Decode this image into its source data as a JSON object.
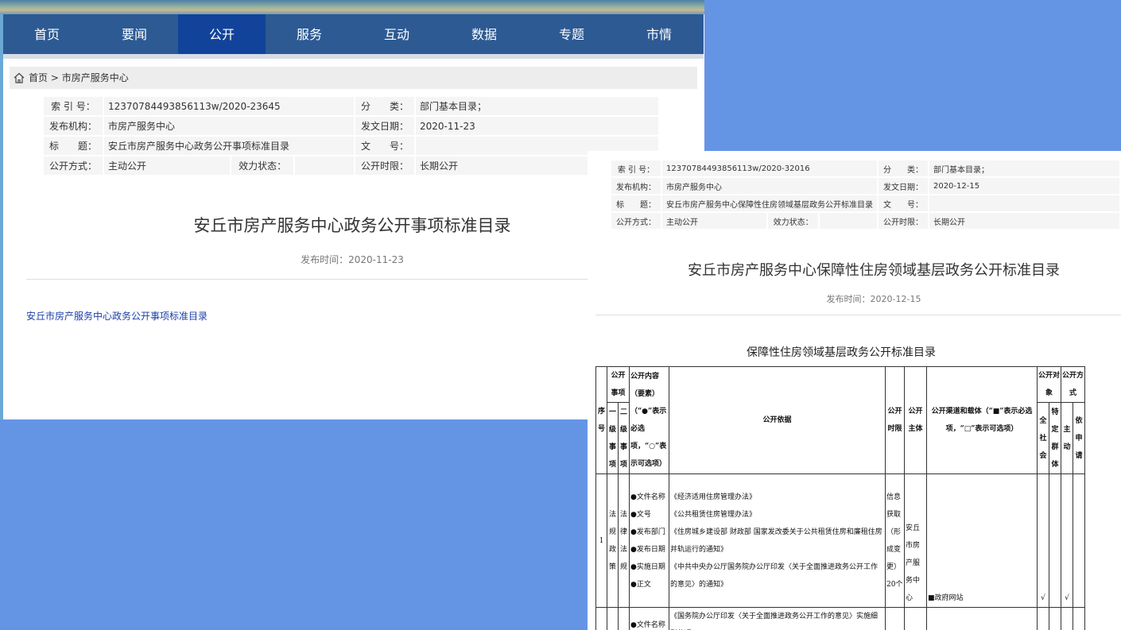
{
  "nav": {
    "items": [
      "首页",
      "要闻",
      "公开",
      "服务",
      "互动",
      "数据",
      "专题",
      "市情"
    ],
    "active": "公开"
  },
  "breadcrumb": {
    "home": "首页",
    "sep": ">",
    "current": "市房产服务中心"
  },
  "doc1": {
    "meta": {
      "index_label": "索 引 号：",
      "index_value": "12370784493856113w/2020-23645",
      "category_label": "分　　类：",
      "category_value": "部门基本目录；",
      "org_label": "发布机构：",
      "org_value": "市房产服务中心",
      "date_label": "发文日期：",
      "date_value": "2020-11-23",
      "title_label": "标　　题：",
      "title_value": "安丘市房产服务中心政务公开事项标准目录",
      "docno_label": "文　　号：",
      "docno_value": "",
      "method_label": "公开方式：",
      "method_value": "主动公开",
      "status_label": "效力状态：",
      "status_value": "",
      "period_label": "公开时限：",
      "period_value": "长期公开"
    },
    "title": "安丘市房产服务中心政务公开事项标准目录",
    "publish_time": "发布时间：2020-11-23",
    "link": "安丘市房产服务中心政务公开事项标准目录"
  },
  "doc2": {
    "meta": {
      "index_label": "索 引 号：",
      "index_value": "12370784493856113w/2020-32016",
      "category_label": "分　　类：",
      "category_value": "部门基本目录；",
      "org_label": "发布机构：",
      "org_value": "市房产服务中心",
      "date_label": "发文日期：",
      "date_value": "2020-12-15",
      "title_label": "标　　题：",
      "title_value": "安丘市房产服务中心保障性住房领域基层政务公开标准目录",
      "docno_label": "文　　号：",
      "docno_value": "",
      "method_label": "公开方式：",
      "method_value": "主动公开",
      "status_label": "效力状态：",
      "status_value": "",
      "period_label": "公开时限：",
      "period_value": "长期公开"
    },
    "title": "安丘市房产服务中心保障性住房领域基层政务公开标准目录",
    "publish_time": "发布时间：2020-12-15",
    "table_title": "保障性住房领域基层政务公开标准目录",
    "table": {
      "h_matters": "公开事项",
      "h_content": "公开内容（要素）（“●”表示必选项，“○”表示可选项）",
      "h_basis": "公开依据",
      "h_time": "公开时限",
      "h_subject": "公开主体",
      "h_channel": "公开渠道和载体（“■”表示必选项，“□”表示可选项）",
      "h_target": "公开对象",
      "h_method": "公开方式",
      "h_seq": "序号",
      "h_level1": "一级事项",
      "h_level2": "二级事项",
      "h_all": "全社会",
      "h_specific": "特定群体",
      "h_active": "主动",
      "h_apply": "依申请",
      "row1": {
        "seq": "1",
        "level1": "法规政策",
        "level2": "法律法规",
        "content": [
          "●文件名称",
          "●文号",
          "●发布部门",
          "●发布日期",
          "●实施日期",
          "●正文"
        ],
        "basis": [
          "《经济适用住房管理办法》",
          "《公共租赁住房管理办法》",
          "《住房城乡建设部 财政部 国家发改委关于公共租赁住房和廉租住房并轨运行的通知》",
          "《中共中央办公厅国务院办公厅印发〈关于全面推进政务公开工作的意见〉的通知》",
          "《国务院办公厅印发〈关于全面推进政务公开工作的意见〉实施细则的通"
        ],
        "time": "信息获取（形成变更）20个",
        "subject": "安丘市房产服务中心",
        "channel": "■政府网站",
        "all": "√",
        "active": "√"
      },
      "row2_content": "●文件名称"
    }
  }
}
